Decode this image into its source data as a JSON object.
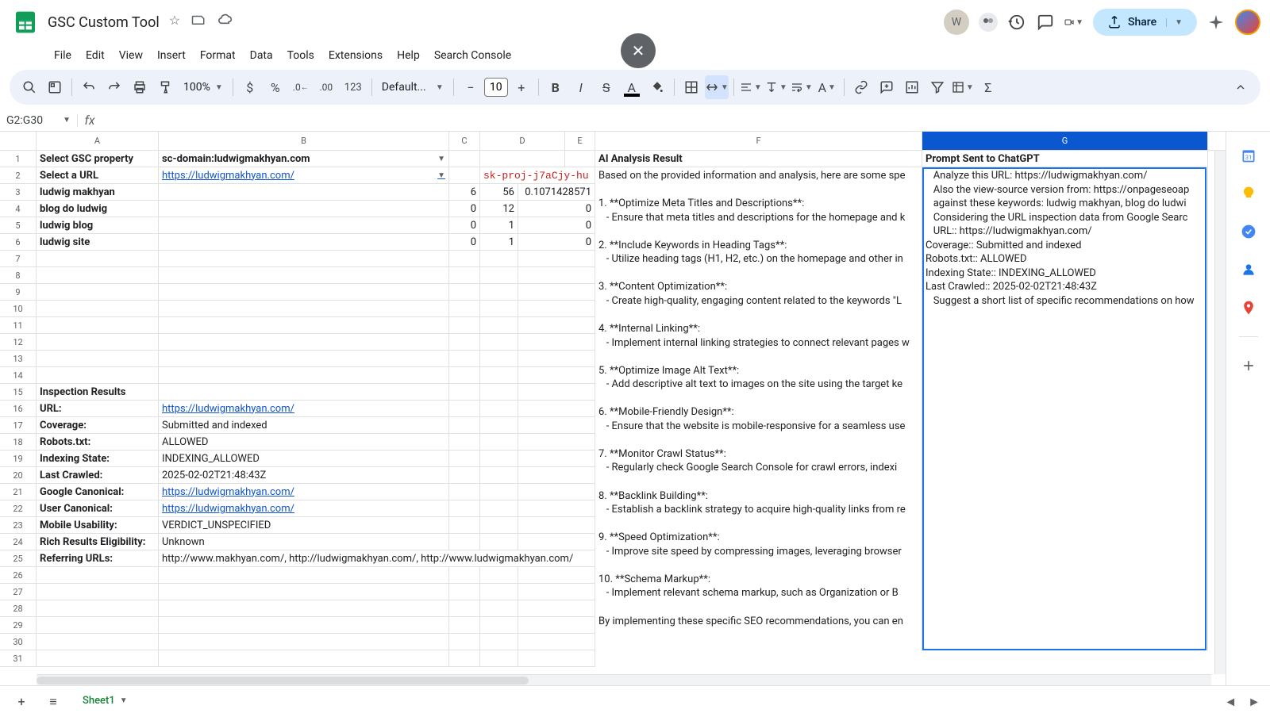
{
  "doc": {
    "title": "GSC Custom Tool"
  },
  "menu": [
    "File",
    "Edit",
    "View",
    "Insert",
    "Format",
    "Data",
    "Tools",
    "Extensions",
    "Help",
    "Search Console"
  ],
  "share": "Share",
  "avatar_letter": "W",
  "zoom": "100%",
  "font_name": "Default...",
  "font_size": "10",
  "fmt_123": "123",
  "name_box": "G2:G30",
  "columns": [
    "A",
    "B",
    "C",
    "D",
    "E",
    "F",
    "G"
  ],
  "rows_count": 31,
  "grid": {
    "r1": {
      "A": "Select GSC property",
      "B": "sc-domain:ludwigmakhyan.com",
      "F": "AI Analysis Result",
      "G": "Prompt Sent to ChatGPT"
    },
    "r2": {
      "A": "Select a URL",
      "B": "https://ludwigmakhyan.com/",
      "D": "sk-proj-j7aCjy-hu"
    },
    "r3": {
      "A": "ludwig makhyan",
      "C": "6",
      "D": "56",
      "E": "0.1071428571"
    },
    "r4": {
      "A": "blog do ludwig",
      "C": "0",
      "D": "12",
      "E": "0"
    },
    "r5": {
      "A": "ludwig blog",
      "C": "0",
      "D": "1",
      "E": "0"
    },
    "r6": {
      "A": "ludwig site",
      "C": "0",
      "D": "1",
      "E": "0"
    },
    "r15": {
      "A": "Inspection Results"
    },
    "r16": {
      "A": "URL:",
      "B": "https://ludwigmakhyan.com/"
    },
    "r17": {
      "A": "Coverage:",
      "B": "Submitted and indexed"
    },
    "r18": {
      "A": "Robots.txt:",
      "B": "ALLOWED"
    },
    "r19": {
      "A": "Indexing State:",
      "B": "INDEXING_ALLOWED"
    },
    "r20": {
      "A": "Last Crawled:",
      "B": "2025-02-02T21:48:43Z"
    },
    "r21": {
      "A": "Google Canonical:",
      "B": "https://ludwigmakhyan.com/"
    },
    "r22": {
      "A": "User Canonical:",
      "B": "https://ludwigmakhyan.com/"
    },
    "r23": {
      "A": "Mobile Usability:",
      "B": "VERDICT_UNSPECIFIED"
    },
    "r24": {
      "A": "Rich Results Eligibility:",
      "B": "Unknown"
    },
    "r25": {
      "A": "Referring URLs:",
      "B": "http://www.makhyan.com/, http://ludwigmakhyan.com/, http://www.ludwigmakhyan.com/"
    }
  },
  "f_block": "Based on the provided information and analysis, here are some spe\n\n1. **Optimize Meta Titles and Descriptions**:\n   - Ensure that meta titles and descriptions for the homepage and k\n\n2. **Include Keywords in Heading Tags**:\n   - Utilize heading tags (H1, H2, etc.) on the homepage and other in\n\n3. **Content Optimization**:\n   - Create high-quality, engaging content related to the keywords \"L\n\n4. **Internal Linking**:\n   - Implement internal linking strategies to connect relevant pages w\n\n5. **Optimize Image Alt Text**:\n   - Add descriptive alt text to images on the site using the target ke\n\n6. **Mobile-Friendly Design**:\n   - Ensure that the website is mobile-responsive for a seamless use\n\n7. **Monitor Crawl Status**:\n   - Regularly check Google Search Console for crawl errors, indexi\n\n8. **Backlink Building**:\n   - Establish a backlink strategy to acquire high-quality links from re\n\n9. **Speed Optimization**:\n   - Improve site speed by compressing images, leveraging browser\n\n10. **Schema Markup**:\n   - Implement relevant schema markup, such as Organization or B\n\nBy implementing these specific SEO recommendations, you can en",
  "g_block": "   Analyze this URL: https://ludwigmakhyan.com/\n   Also the view-source version from: https://onpageseoap\n   against these keywords: ludwig makhyan, blog do ludwi\n   Considering the URL inspection data from Google Searc\n   URL:: https://ludwigmakhyan.com/\nCoverage:: Submitted and indexed\nRobots.txt:: ALLOWED\nIndexing State:: INDEXING_ALLOWED\nLast Crawled:: 2025-02-02T21:48:43Z\n   Suggest a short list of specific recommendations on how",
  "sheet_tab": "Sheet1"
}
